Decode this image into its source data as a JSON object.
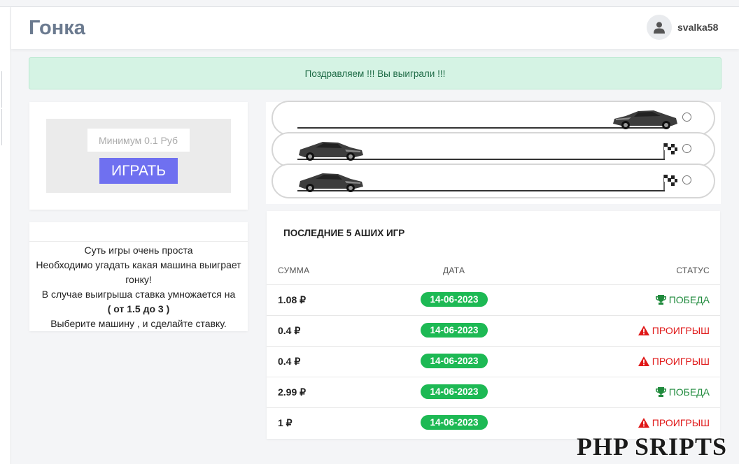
{
  "header": {
    "title": "Гонка",
    "username": "svalka58"
  },
  "alert": {
    "message": "Поздравляем !!! Вы выиграли !!!"
  },
  "bet": {
    "placeholder": "Минимум 0.1 Руб",
    "play_label": "ИГРАТЬ"
  },
  "info": {
    "line1": "Суть игры очень проста",
    "line2": "Необходимо угадать какая машина выиграет гонку!",
    "line3": "В случае выигрыша ставка умножается на",
    "line4": "( от 1.5 до 3 )",
    "line5": "Выберите машину , и сделайте ставку."
  },
  "race": {
    "tracks": [
      {
        "car_position": "finish",
        "selected": false
      },
      {
        "car_position": "start",
        "selected": false
      },
      {
        "car_position": "start",
        "selected": false
      }
    ]
  },
  "games": {
    "title": "ПОСЛЕДНИЕ 5 АШИХ ИГР",
    "columns": {
      "sum": "СУММА",
      "date": "ДАТА",
      "status": "СТАТУС"
    },
    "rows": [
      {
        "sum": "1.08 ₽",
        "date": "14-06-2023",
        "status": "ПОБЕДА",
        "result": "win"
      },
      {
        "sum": "0.4 ₽",
        "date": "14-06-2023",
        "status": "ПРОИГРЫШ",
        "result": "lose"
      },
      {
        "sum": "0.4 ₽",
        "date": "14-06-2023",
        "status": "ПРОИГРЫШ",
        "result": "lose"
      },
      {
        "sum": "2.99 ₽",
        "date": "14-06-2023",
        "status": "ПОБЕДА",
        "result": "win"
      },
      {
        "sum": "1 ₽",
        "date": "14-06-2023",
        "status": "ПРОИГРЫШ",
        "result": "lose"
      }
    ]
  },
  "watermark": "PHP SRIPTS",
  "colors": {
    "accent": "#6f70f0",
    "win": "#1f8a3c",
    "lose": "#e01818",
    "date_badge": "#1db954",
    "alert_bg": "#d5f3e4"
  }
}
